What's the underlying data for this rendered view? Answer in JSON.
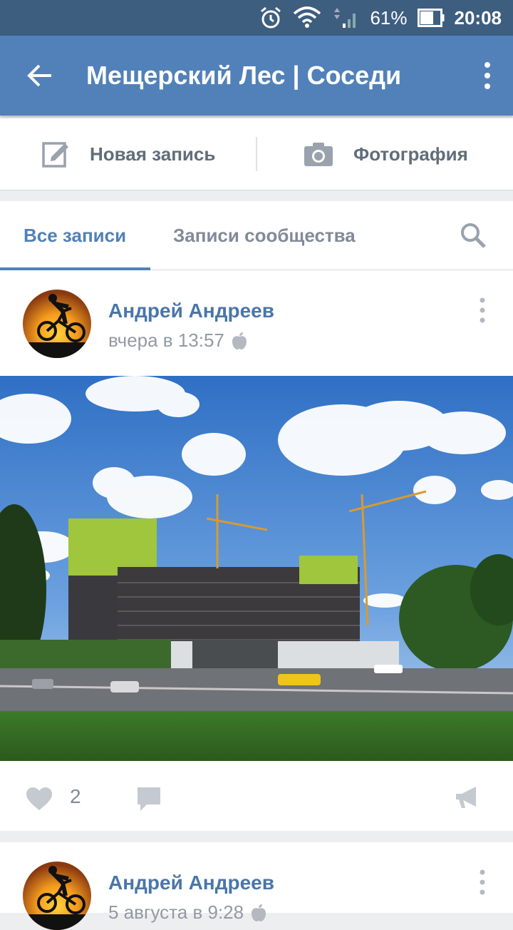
{
  "status": {
    "battery": "61%",
    "time": "20:08",
    "icons": [
      "alarm-icon",
      "wifi-icon",
      "signal-icon",
      "battery-icon"
    ]
  },
  "header": {
    "title": "Мещерский Лес | Соседи",
    "back_icon": "arrow-back-icon",
    "menu_icon": "more-vert-icon"
  },
  "actions": {
    "new_post": "Новая запись",
    "photo": "Фотография"
  },
  "tabs": {
    "all": "Все записи",
    "community": "Записи сообщества"
  },
  "posts": [
    {
      "author": "Андрей Андреев",
      "time": "вчера в 13:57",
      "likes": "2"
    },
    {
      "author": "Андрей Андреев",
      "time": "5 августа в 9:28"
    }
  ],
  "colors": {
    "statusbar": "#3e5e80",
    "header": "#5181b8",
    "accent": "#4a76a8",
    "muted": "#828a99"
  }
}
